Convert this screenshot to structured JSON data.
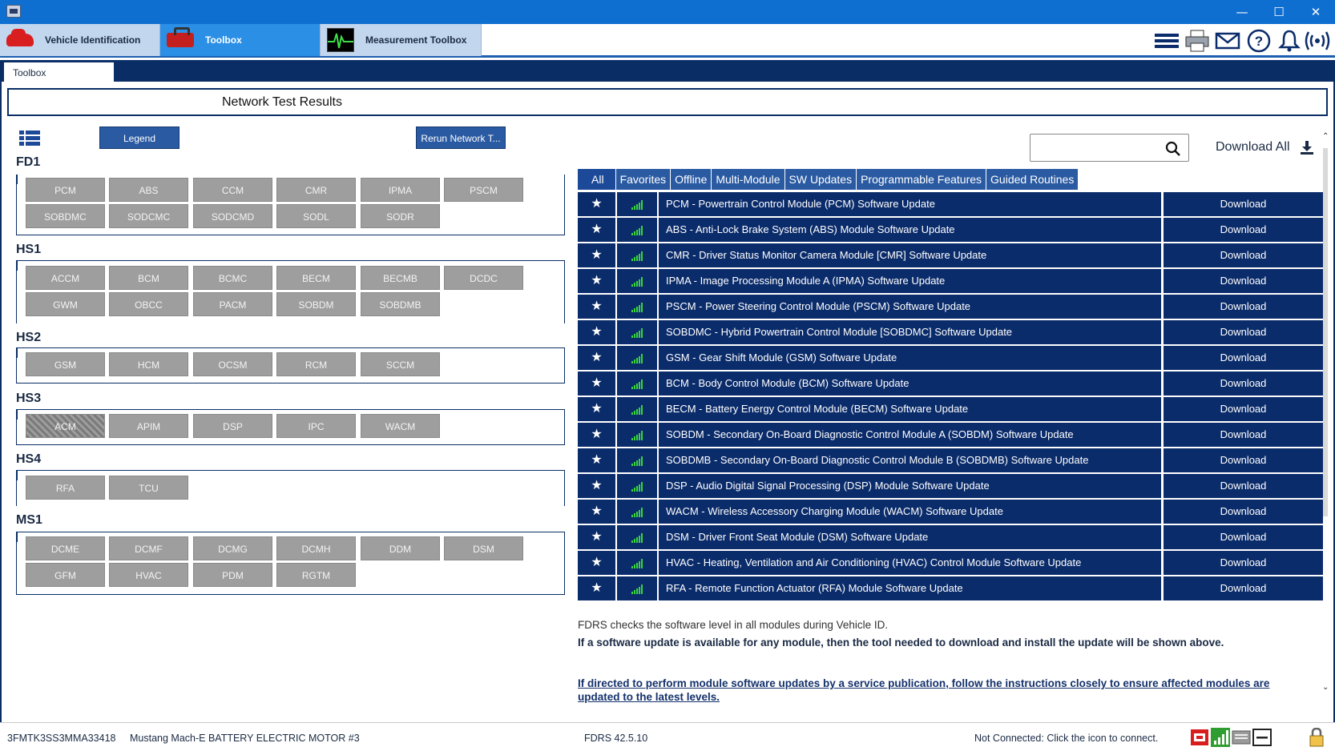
{
  "window": {
    "minimize": "—",
    "maximize": "☐",
    "close": "✕"
  },
  "top_tabs": [
    {
      "label": "Vehicle Identification",
      "icon": "car-icon"
    },
    {
      "label": "Toolbox",
      "icon": "toolbox-icon"
    },
    {
      "label": "Measurement Toolbox",
      "icon": "oscilloscope-icon"
    }
  ],
  "header_icons": [
    "menu-icon",
    "printer-icon",
    "mail-icon",
    "help-icon",
    "bell-icon",
    "wireless-icon"
  ],
  "subtab": "Toolbox",
  "header_title": "Network Test Results",
  "left": {
    "legend_label": "Legend",
    "rerun_label": "Rerun Network T...",
    "buses": [
      {
        "name": "FD1",
        "modules": [
          "PCM",
          "ABS",
          "CCM",
          "CMR",
          "IPMA",
          "PSCM",
          "SOBDMC",
          "SODCMC",
          "SODCMD",
          "SODL",
          "SODR"
        ]
      },
      {
        "name": "HS1",
        "modules": [
          "ACCM",
          "BCM",
          "BCMC",
          "BECM",
          "BECMB",
          "DCDC",
          "GWM",
          "OBCC",
          "PACM",
          "SOBDM",
          "SOBDMB"
        ]
      },
      {
        "name": "HS2",
        "modules": [
          "GSM",
          "HCM",
          "OCSM",
          "RCM",
          "SCCM"
        ]
      },
      {
        "name": "HS3",
        "modules": [
          "ACM",
          "APIM",
          "DSP",
          "IPC",
          "WACM"
        ]
      },
      {
        "name": "HS4",
        "modules": [
          "RFA",
          "TCU"
        ]
      },
      {
        "name": "MS1",
        "modules": [
          "DCME",
          "DCMF",
          "DCMG",
          "DCMH",
          "DDM",
          "DSM",
          "GFM",
          "HVAC",
          "PDM",
          "RGTM"
        ]
      }
    ]
  },
  "right": {
    "search_value": "",
    "download_all_label": "Download All",
    "filters": [
      "All",
      "Favorites",
      "Offline",
      "Multi-Module",
      "SW Updates",
      "Programmable Features",
      "Guided Routines"
    ],
    "rows": [
      {
        "desc": "PCM - Powertrain Control Module (PCM) Software Update",
        "action": "Download"
      },
      {
        "desc": "ABS - Anti-Lock Brake System (ABS) Module Software Update",
        "action": "Download"
      },
      {
        "desc": "CMR - Driver Status Monitor Camera Module [CMR] Software Update",
        "action": "Download"
      },
      {
        "desc": "IPMA - Image Processing Module A (IPMA) Software Update",
        "action": "Download"
      },
      {
        "desc": "PSCM - Power Steering Control Module (PSCM) Software Update",
        "action": "Download"
      },
      {
        "desc": "SOBDMC - Hybrid Powertrain Control Module [SOBDMC] Software Update",
        "action": "Download"
      },
      {
        "desc": "GSM - Gear Shift Module (GSM) Software Update",
        "action": "Download"
      },
      {
        "desc": "BCM - Body Control Module (BCM) Software Update",
        "action": "Download"
      },
      {
        "desc": "BECM - Battery Energy Control Module (BECM) Software Update",
        "action": "Download"
      },
      {
        "desc": "SOBDM - Secondary On-Board Diagnostic Control Module A (SOBDM) Software Update",
        "action": "Download"
      },
      {
        "desc": "SOBDMB - Secondary On-Board Diagnostic Control Module B (SOBDMB) Software Update",
        "action": "Download"
      },
      {
        "desc": "DSP - Audio Digital Signal Processing (DSP) Module Software Update",
        "action": "Download"
      },
      {
        "desc": "WACM - Wireless Accessory Charging Module (WACM) Software Update",
        "action": "Download"
      },
      {
        "desc": "DSM - Driver Front Seat Module (DSM) Software Update",
        "action": "Download"
      },
      {
        "desc": "HVAC - Heating, Ventilation and Air Conditioning (HVAC) Control Module Software Update",
        "action": "Download"
      },
      {
        "desc": "RFA - Remote Function Actuator (RFA) Module Software Update",
        "action": "Download"
      }
    ],
    "info_1": "FDRS checks the software level in all modules during Vehicle ID.",
    "info_2": "If a software update is available for any module, then the tool needed to download and install the update will be shown above.",
    "info_link": "If directed to perform module software updates by a service publication, follow the instructions closely to ensure affected modules are updated to the latest levels."
  },
  "status": {
    "vin": "3FMTK3SS3MMA33418",
    "vehicle": "Mustang Mach-E BATTERY ELECTRIC MOTOR #3",
    "version": "FDRS 42.5.10",
    "connection": "Not Connected: Click the icon to connect.",
    "icons": [
      "vci-red-icon",
      "signal-icon",
      "keyboard-icon",
      "dash-icon",
      "lock-icon"
    ]
  }
}
